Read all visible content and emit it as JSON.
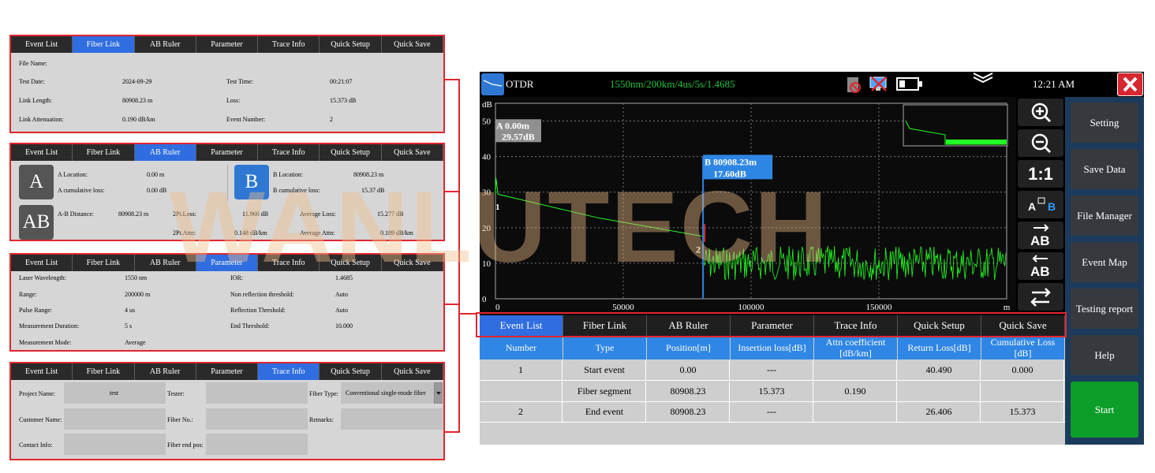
{
  "watermark": "WANLUTECH",
  "tabs": [
    "Event List",
    "Fiber Link",
    "AB Ruler",
    "Parameter",
    "Trace Info",
    "Quick Setup",
    "Quick Save"
  ],
  "fiber_link": {
    "file_name": "File Name:",
    "test_date_label": "Test Date:",
    "test_date": "2024-09-29",
    "test_time_label": "Test Time:",
    "test_time": "00:21:07",
    "link_length_label": "Link Length:",
    "link_length": "80908.23 m",
    "loss_label": "Loss:",
    "loss": "15.373 dB",
    "link_attn_label": "Link Attenuation:",
    "link_attn": "0.190 dB/km",
    "event_number_label": "Event Number:",
    "event_number": "2"
  },
  "ab_ruler": {
    "a_btn": "A",
    "b_btn": "B",
    "ab_btn": "AB",
    "a_loc_label": "A Location:",
    "a_loc": "0.00 m",
    "a_cum_label": "A cumulative loss:",
    "a_cum": "0.00 dB",
    "b_loc_label": "B Location:",
    "b_loc": "80908.23 m",
    "b_cum_label": "B cumulative loss:",
    "b_cum": "15.37 dB",
    "ab_dist_label": "A-B Distance:",
    "ab_dist": "80908.23 m",
    "pt2loss_label": "2Pt.Loss:",
    "pt2loss": "11.960 dB",
    "avg_loss_label": "Average Loss:",
    "avg_loss": "15.277 dB",
    "pt2attn_label": "2Pt.Attn:",
    "pt2attn": "0.148 dB/km",
    "avg_attn_label": "Average Attn:",
    "avg_attn": "0.189 dB/km"
  },
  "parameter": {
    "laser_label": "Laser Wavelength:",
    "laser": "1550 nm",
    "ior_label": "IOR:",
    "ior": "1.4685",
    "range_label": "Range:",
    "range": "200000 m",
    "nonrefl_label": "Non reflection threshold:",
    "nonrefl": "Auto",
    "pulse_label": "Pulse Range:",
    "pulse": "4 us",
    "refl_label": "Reflection Threshold:",
    "refl": "Auto",
    "duration_label": "Measurement Duration:",
    "duration": "5 s",
    "end_label": "End Threshold:",
    "end": "10.000",
    "mode_label": "Measurement Mode:",
    "mode": "Average"
  },
  "trace_info": {
    "project_label": "Project Name:",
    "project": "test",
    "tester_label": "Tester:",
    "fiber_type_label": "Fiber Type:",
    "fiber_type": "Conventional single-mode fiber",
    "customer_label": "Customer Name:",
    "fiber_no_label": "Fiber No.:",
    "remarks_label": "Remarks:",
    "contact_label": "Contact Info:",
    "fiber_end_label": "Fiber end pos:"
  },
  "otdr": {
    "title": "OTDR",
    "params": "1550nm/200km/4us/5s/1.4685",
    "time": "12:21 AM",
    "marker_a": "A 0.00m",
    "marker_a_db": "29.57dB",
    "marker_b": "B  80908.23m",
    "marker_b_db": "17.60dB",
    "event1": "1",
    "event2": "2",
    "tool_1to1": "1:1",
    "side_buttons": [
      "Setting",
      "Save Data",
      "File Manager",
      "Event Map",
      "Testing report",
      "Help",
      "Start"
    ],
    "headers": [
      "Number",
      "Type",
      "Position[m]",
      "Insertion loss[dB]",
      "Attn coefficient [dB/km]",
      "Return Loss[dB]",
      "Cumulative Loss [dB]"
    ],
    "rows": [
      [
        "1",
        "Start event",
        "0.00",
        "---",
        "",
        "40.490",
        "0.000"
      ],
      [
        "",
        "Fiber segment",
        "80908.23",
        "15.373",
        "0.190",
        "",
        ""
      ],
      [
        "2",
        "End event",
        "80908.23",
        "---",
        "",
        "26.406",
        "15.373"
      ]
    ]
  },
  "chart_data": {
    "type": "line",
    "xlabel": "m",
    "ylabel": "dB",
    "xlim": [
      0,
      200000
    ],
    "ylim": [
      0,
      55
    ],
    "xticks": [
      "0",
      "50000",
      "100000",
      "150000",
      "m"
    ],
    "yticks": [
      "0",
      "10",
      "20",
      "30",
      "40",
      "50"
    ],
    "series": [
      {
        "x": [
          0,
          200,
          1000,
          40000,
          80908
        ],
        "y": [
          29.57,
          34,
          29.4,
          22.8,
          17.6
        ]
      },
      {
        "x": [
          80908,
          200000
        ],
        "y": [
          10,
          10
        ]
      }
    ],
    "grid": true,
    "colors": {
      "trace": "#22ff22",
      "grid": "#777777",
      "marker_a": "#909090",
      "marker_b": "#2e86e4"
    }
  },
  "colors": {
    "accent": "#2f6de0",
    "highlight": "#e0262e",
    "start": "#0c9e28"
  }
}
